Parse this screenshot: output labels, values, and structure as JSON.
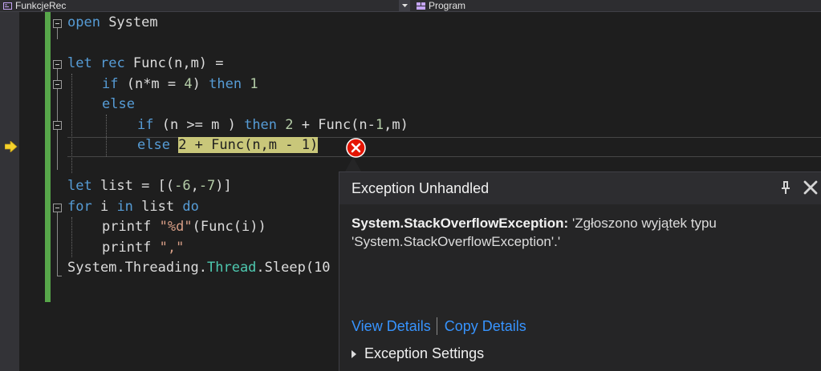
{
  "navbar": {
    "left_label": "FunkcjeRec",
    "right_label": "Program"
  },
  "code_lines": [
    [
      "open System"
    ],
    [
      ""
    ],
    [
      "let rec Func(n,m) ="
    ],
    [
      "if (n*m = 4) then 1"
    ],
    [
      "else"
    ],
    [
      "if (n >= m ) then 2 + Func(n-1,m)"
    ],
    [
      "else 2 + Func(n,m - 1)"
    ],
    [
      ""
    ],
    [
      "let list = [(-6,-7)]"
    ],
    [
      "for i in list do"
    ],
    [
      "printf \"%d\"(Func(i))"
    ],
    [
      "printf \",\""
    ],
    [
      "System.Threading.Thread.Sleep(10"
    ]
  ],
  "code": {
    "l1_kw": "open",
    "l1_rest": " System",
    "l3_kw1": "let",
    "l3_kw2": "rec",
    "l3_rest": " Func(n,m) =",
    "l4_kw1": "if",
    "l4_a": " (n*m = ",
    "l4_n1": "4",
    "l4_b": ") ",
    "l4_kw2": "then",
    "l4_c": " ",
    "l4_n2": "1",
    "l5_kw": "else",
    "l6_kw1": "if",
    "l6_a": " (n >= m ) ",
    "l6_kw2": "then",
    "l6_b": " ",
    "l6_n1": "2",
    "l6_c": " + Func(n-",
    "l6_n2": "1",
    "l6_d": ",m)",
    "l7_kw": "else",
    "l7_sp": " ",
    "l7_hl": "2 + Func(n,m - 1)",
    "l9_kw": "let",
    "l9_a": " list = [(",
    "l9_n1": "-6",
    "l9_b": ",",
    "l9_n2": "-7",
    "l9_c": ")]",
    "l10_kw1": "for",
    "l10_a": " i ",
    "l10_kw2": "in",
    "l10_b": " list ",
    "l10_kw3": "do",
    "l11_a": "printf ",
    "l11_str": "\"%d\"",
    "l11_b": "(Func(i))",
    "l12_a": "printf ",
    "l12_str": "\",\"",
    "l13_a": "System.Threading.",
    "l13_type": "Thread",
    "l13_b": ".Sleep(10"
  },
  "exception_popup": {
    "title": "Exception Unhandled",
    "exception_type": "System.StackOverflowException:",
    "message": " 'Zgłoszono wyjątek typu 'System.StackOverflowException'.'",
    "view_details": "View Details",
    "copy_details": "Copy Details",
    "settings": "Exception Settings"
  },
  "colors": {
    "background": "#1e1e1e",
    "keyword": "#569cd6",
    "number": "#b5cea8",
    "string": "#d69d85",
    "type": "#4ec9b0",
    "highlight": "#c9c77a",
    "link": "#3794ff",
    "change_bar": "#57a64a"
  }
}
